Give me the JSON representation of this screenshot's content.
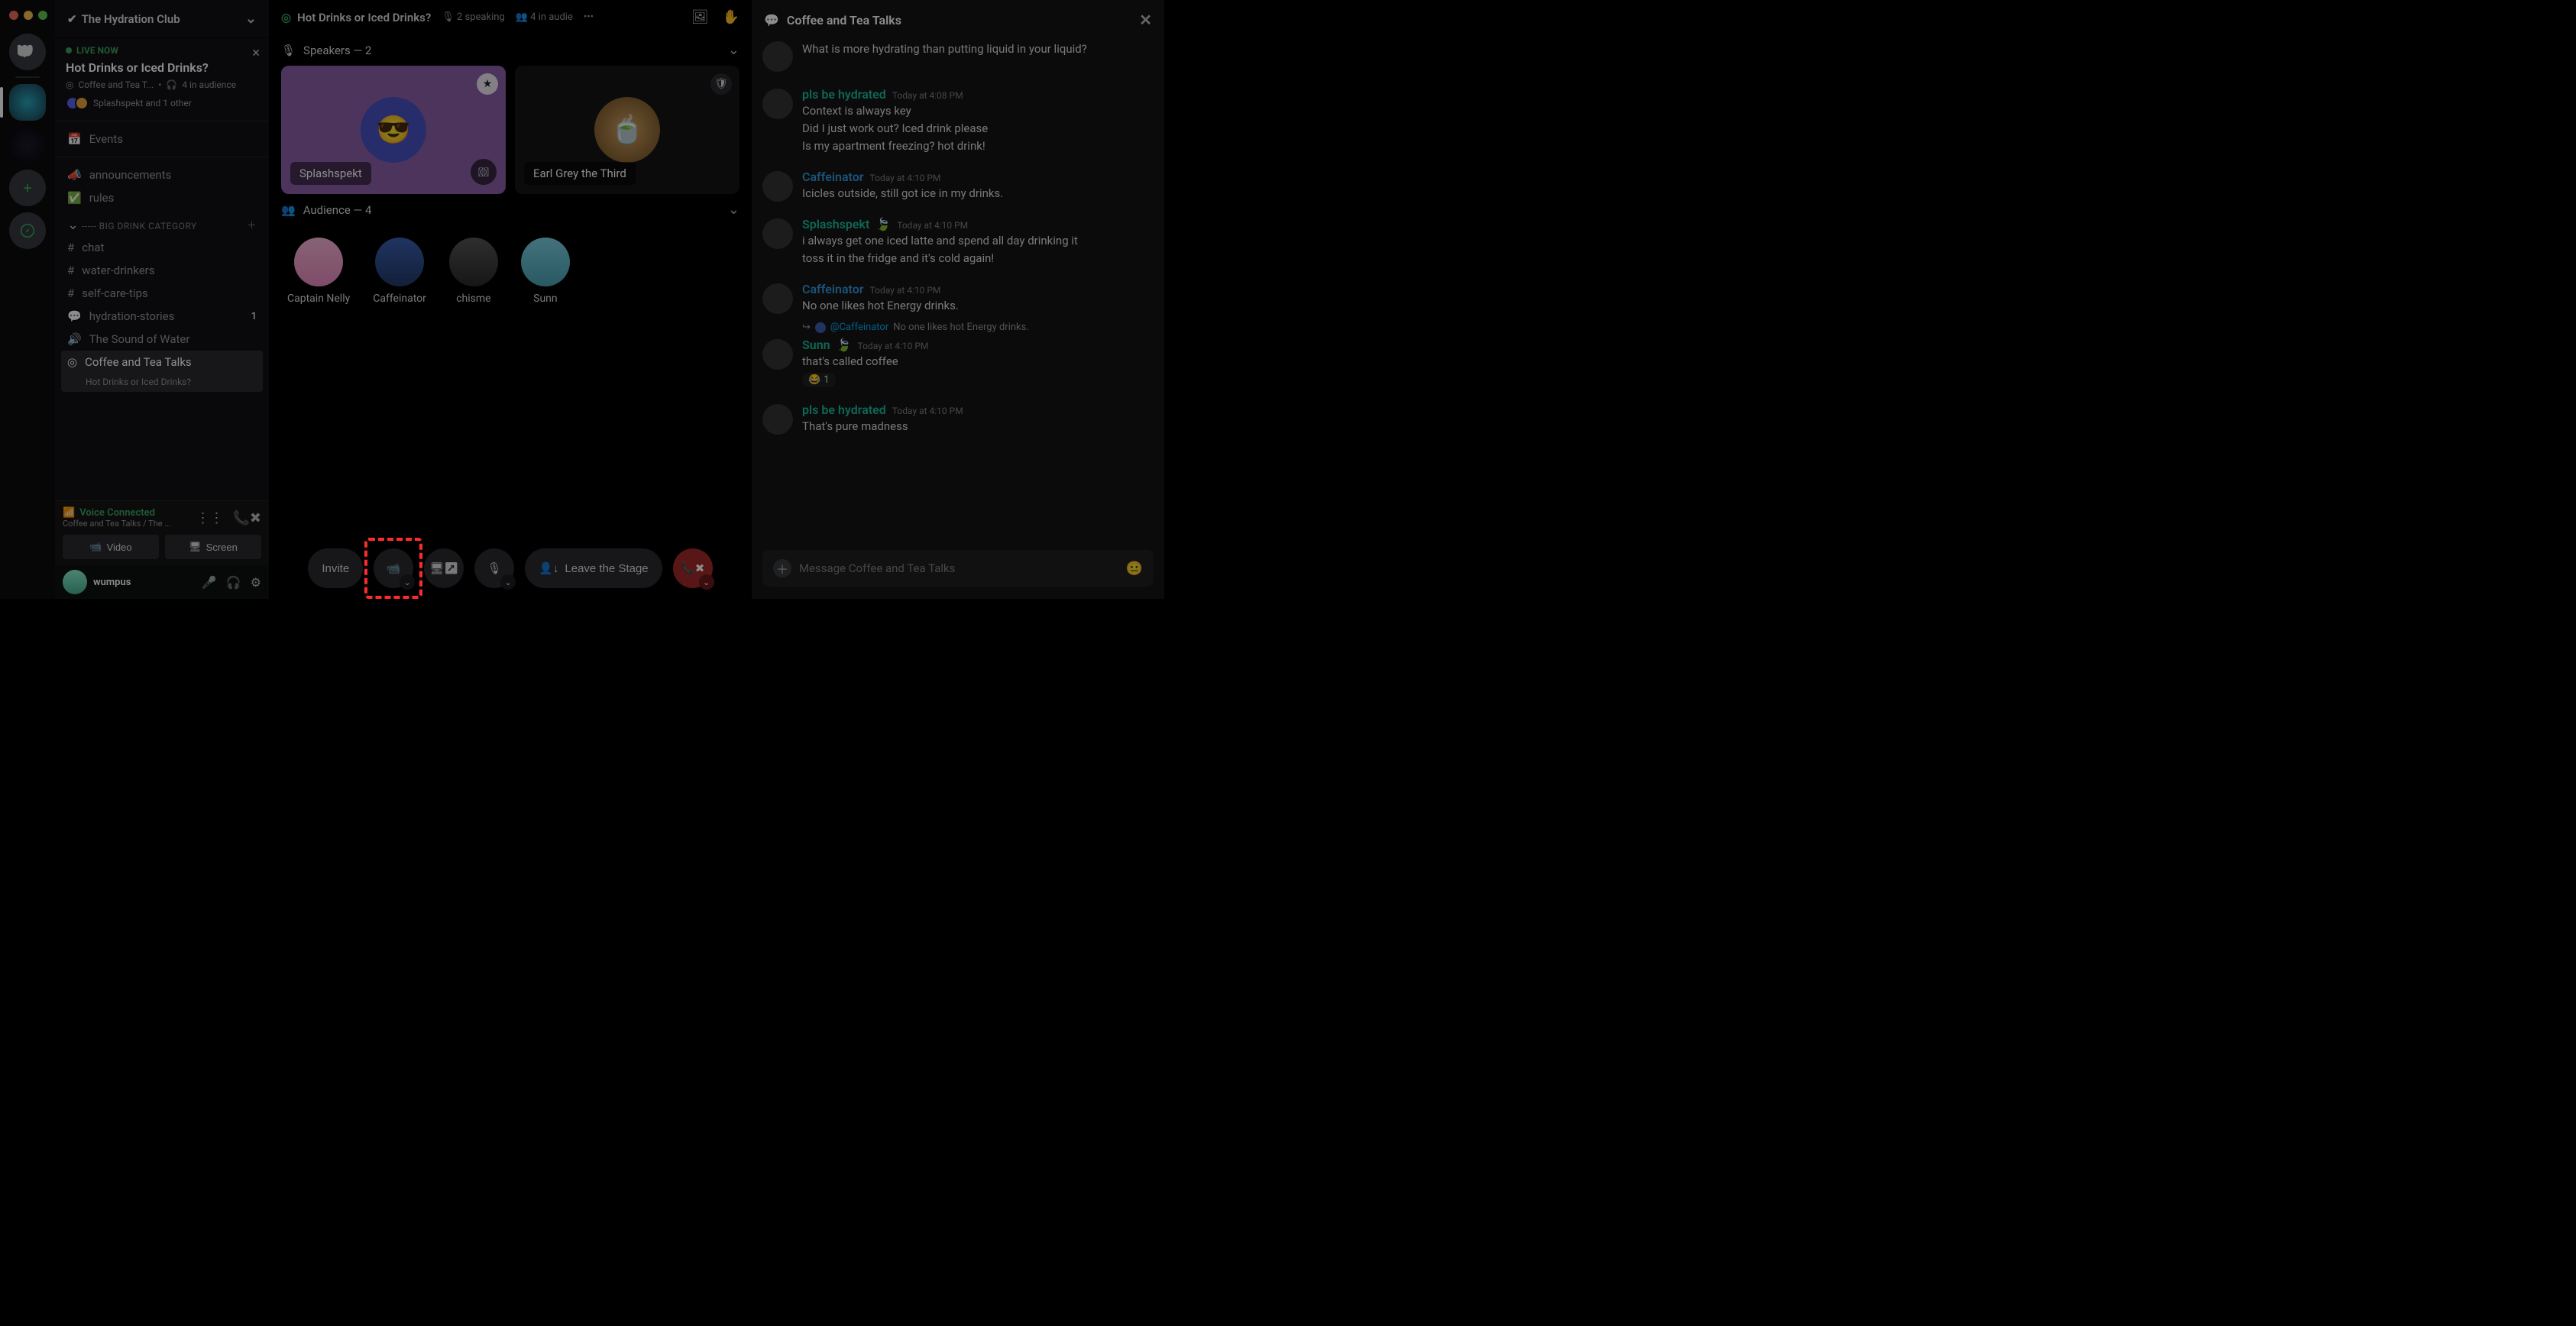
{
  "server_list": {
    "dm_tooltip": "Direct Messages",
    "active_server": "The Hydration Club",
    "add_label": "+",
    "explore_label": "compass"
  },
  "server_header": {
    "name": "The Hydration Club"
  },
  "live_card": {
    "badge": "LIVE NOW",
    "title": "Hot Drinks or Iced Drinks?",
    "channel": "Coffee and Tea T...",
    "audience": "4 in audience",
    "presence": "Splashspekt and 1 other"
  },
  "events_label": "Events",
  "top_channels": [
    {
      "icon": "megaphone-icon",
      "name": "announcements"
    },
    {
      "icon": "rules-icon",
      "name": "rules"
    }
  ],
  "category": {
    "name": "----- BIG DRINK CATEGORY"
  },
  "channels": [
    {
      "icon": "hash-icon",
      "name": "chat"
    },
    {
      "icon": "hash-icon",
      "name": "water-drinkers"
    },
    {
      "icon": "hash-icon",
      "name": "self-care-tips"
    },
    {
      "icon": "thread-icon",
      "name": "hydration-stories",
      "unread": "1"
    },
    {
      "icon": "speaker-icon",
      "name": "The Sound of Water"
    },
    {
      "icon": "stage-icon",
      "name": "Coffee and Tea Talks",
      "sub": "Hot Drinks or Iced Drinks?",
      "active": true
    }
  ],
  "voice_panel": {
    "status": "Voice Connected",
    "sub": "Coffee and Tea Talks / The ...",
    "video_btn": "Video",
    "screen_btn": "Screen"
  },
  "user_panel": {
    "name": "wumpus"
  },
  "stage": {
    "title": "Hot Drinks or Iced Drinks?",
    "speaking": "2 speaking",
    "audience_hdr": "4 in audie",
    "speakers_hdr": "Speakers — 2",
    "audience_lbl": "Audience — 4",
    "speakers": [
      {
        "name": "Splashspekt",
        "active": true,
        "muted": true
      },
      {
        "name": "Earl Grey the Third",
        "active": false,
        "muted": false
      }
    ],
    "audience": [
      {
        "name": "Captain Nelly"
      },
      {
        "name": "Caffeinator"
      },
      {
        "name": "chisme"
      },
      {
        "name": "Sunn"
      }
    ],
    "controls": {
      "invite": "Invite",
      "leave": "Leave the Stage"
    }
  },
  "chat": {
    "header": "Coffee and Tea Talks",
    "partial_first": "What is more hydrating than putting liquid in your liquid?",
    "messages": [
      {
        "user": "pls be hydrated",
        "color": "u-teal",
        "ts": "Today at 4:08 PM",
        "lines": [
          "Context is always key",
          "Did I just work out? Iced drink please",
          "Is my apartment freezing? hot drink!"
        ]
      },
      {
        "user": "Caffeinator",
        "color": "u-blue",
        "ts": "Today at 4:10 PM",
        "lines": [
          "Icicles outside, still got ice in my drinks."
        ]
      },
      {
        "user": "Splashspekt",
        "color": "u-teal",
        "badge": "🍃",
        "ts": "Today at 4:10 PM",
        "lines": [
          "i always get one iced latte and spend all day drinking it",
          "toss it in the fridge and it's cold again!"
        ]
      },
      {
        "user": "Caffeinator",
        "color": "u-blue",
        "ts": "Today at 4:10 PM",
        "lines": [
          "No one likes hot Energy drinks."
        ]
      },
      {
        "reply": {
          "user": "@Caffeinator",
          "text": "No one likes hot Energy drinks."
        },
        "user": "Sunn",
        "color": "u-teal",
        "badge": "🍃",
        "ts": "Today at 4:10 PM",
        "lines": [
          "that's called coffee"
        ],
        "reaction": {
          "emoji": "😂",
          "count": "1"
        }
      },
      {
        "user": "pls be hydrated",
        "color": "u-teal",
        "ts": "Today at 4:10 PM",
        "lines": [
          "That's pure madness"
        ]
      }
    ],
    "input_placeholder": "Message Coffee and Tea Talks"
  }
}
